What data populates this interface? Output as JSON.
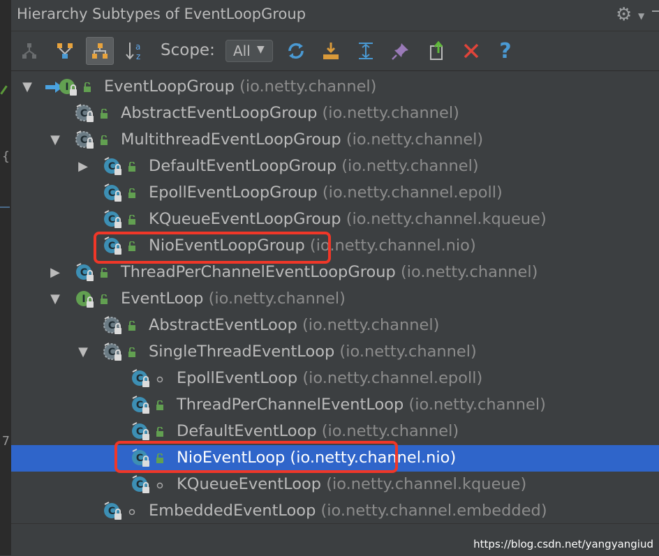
{
  "window": {
    "title": "Hierarchy Subtypes of EventLoopGroup"
  },
  "gutter": {
    "line_mark": "7"
  },
  "toolbar": {
    "buttons": [
      {
        "icon": "supertypes-hierarchy-icon",
        "state": "disabled"
      },
      {
        "icon": "supertypes-icon",
        "state": "normal"
      },
      {
        "icon": "subtypes-hierarchy-icon",
        "state": "pressed"
      },
      {
        "icon": "sort-alphabetically-icon",
        "state": "normal"
      },
      {
        "icon": "refresh-icon",
        "state": "normal"
      },
      {
        "icon": "expand-all-icon",
        "state": "normal"
      },
      {
        "icon": "collapse-all-icon",
        "state": "normal"
      },
      {
        "icon": "pin-icon",
        "state": "normal"
      },
      {
        "icon": "export-icon",
        "state": "normal"
      },
      {
        "icon": "close-icon",
        "state": "normal"
      },
      {
        "icon": "help-icon",
        "state": "normal"
      }
    ],
    "scope_label": "Scope:",
    "scope_value": "All"
  },
  "tree": {
    "rows": [
      {
        "name": "EventLoopGroup",
        "package": "(io.netty.channel)",
        "kind": "interface",
        "access": "public",
        "toggle": "expanded",
        "level": 0,
        "root": true
      },
      {
        "name": "AbstractEventLoopGroup",
        "package": "(io.netty.channel)",
        "kind": "abstract-class",
        "access": "public",
        "toggle": "none",
        "level": 1
      },
      {
        "name": "MultithreadEventLoopGroup",
        "package": "(io.netty.channel)",
        "kind": "abstract-class",
        "access": "public",
        "toggle": "expanded",
        "level": 1
      },
      {
        "name": "DefaultEventLoopGroup",
        "package": "(io.netty.channel)",
        "kind": "class",
        "access": "public",
        "toggle": "collapsed",
        "level": 2
      },
      {
        "name": "EpollEventLoopGroup",
        "package": "(io.netty.channel.epoll)",
        "kind": "class",
        "access": "public",
        "toggle": "none",
        "level": 2
      },
      {
        "name": "KQueueEventLoopGroup",
        "package": "(io.netty.channel.kqueue)",
        "kind": "class",
        "access": "public",
        "toggle": "none",
        "level": 2
      },
      {
        "name": "NioEventLoopGroup",
        "package": "(io.netty.channel.nio)",
        "kind": "class",
        "access": "public",
        "toggle": "none",
        "level": 2,
        "highlighted": true
      },
      {
        "name": "ThreadPerChannelEventLoopGroup",
        "package": "(io.netty.channel)",
        "kind": "class",
        "access": "public",
        "toggle": "collapsed",
        "level": 1
      },
      {
        "name": "EventLoop",
        "package": "(io.netty.channel)",
        "kind": "interface",
        "access": "public",
        "toggle": "expanded",
        "level": 1
      },
      {
        "name": "AbstractEventLoop",
        "package": "(io.netty.channel)",
        "kind": "abstract-class",
        "access": "public",
        "toggle": "none",
        "level": 2
      },
      {
        "name": "SingleThreadEventLoop",
        "package": "(io.netty.channel)",
        "kind": "abstract-class",
        "access": "public",
        "toggle": "expanded",
        "level": 2
      },
      {
        "name": "EpollEventLoop",
        "package": "(io.netty.channel.epoll)",
        "kind": "class",
        "access": "package-private",
        "toggle": "none",
        "level": 3
      },
      {
        "name": "ThreadPerChannelEventLoop",
        "package": "(io.netty.channel)",
        "kind": "class",
        "access": "public",
        "toggle": "none",
        "level": 3
      },
      {
        "name": "DefaultEventLoop",
        "package": "(io.netty.channel)",
        "kind": "class",
        "access": "public",
        "toggle": "none",
        "level": 3
      },
      {
        "name": "NioEventLoop",
        "package": "(io.netty.channel.nio)",
        "kind": "class",
        "access": "public",
        "toggle": "none",
        "level": 3,
        "selected": true,
        "highlighted": true
      },
      {
        "name": "KQueueEventLoop",
        "package": "(io.netty.channel.kqueue)",
        "kind": "class",
        "access": "package-private",
        "toggle": "none",
        "level": 3
      },
      {
        "name": "EmbeddedEventLoop",
        "package": "(io.netty.channel.embedded)",
        "kind": "class",
        "access": "package-private",
        "toggle": "none",
        "level": 2
      }
    ]
  },
  "colors": {
    "background": "#3c3f41",
    "selection": "#2f65ca",
    "class_icon": "#3d8fb4",
    "interface_icon": "#62a051",
    "annotation_red": "#f03728"
  },
  "watermark": "https://blog.csdn.net/yangyangiud"
}
